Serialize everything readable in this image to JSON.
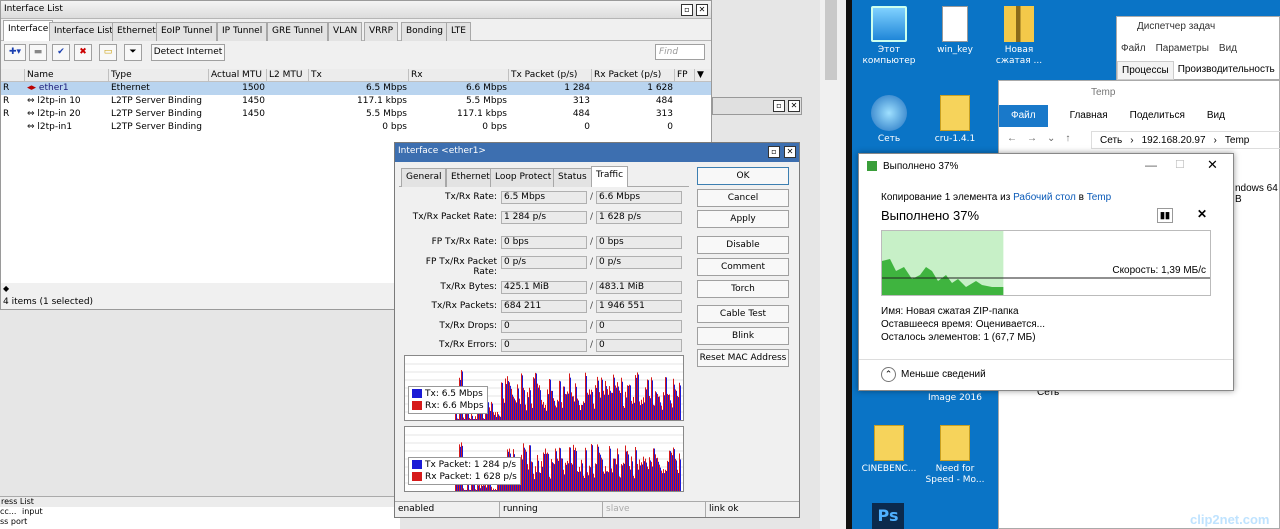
{
  "interface_list": {
    "title": "Interface List",
    "tabs": [
      "Interface",
      "Interface List",
      "Ethernet",
      "EoIP Tunnel",
      "IP Tunnel",
      "GRE Tunnel",
      "VLAN",
      "VRRP",
      "Bonding",
      "LTE"
    ],
    "detect_label": "Detect Internet",
    "find_placeholder": "Find",
    "columns": [
      "Name",
      "Type",
      "Actual MTU",
      "L2 MTU",
      "Tx",
      "Rx",
      "Tx Packet (p/s)",
      "Rx Packet (p/s)",
      "FP"
    ],
    "rows": [
      {
        "flag": "R",
        "name": "ether1",
        "type": "Ethernet",
        "mtu": "1500",
        "l2mtu": "",
        "tx": "6.5 Mbps",
        "rx": "6.6 Mbps",
        "txp": "1 284",
        "rxp": "1 628"
      },
      {
        "flag": "R",
        "name": "l2tp-in 10",
        "type": "L2TP Server Binding",
        "mtu": "1450",
        "l2mtu": "",
        "tx": "117.1 kbps",
        "rx": "5.5 Mbps",
        "txp": "313",
        "rxp": "484"
      },
      {
        "flag": "R",
        "name": "l2tp-in 20",
        "type": "L2TP Server Binding",
        "mtu": "1450",
        "l2mtu": "",
        "tx": "5.5 Mbps",
        "rx": "117.1 kbps",
        "txp": "484",
        "rxp": "313"
      },
      {
        "flag": "",
        "name": "l2tp-in1",
        "type": "L2TP Server Binding",
        "mtu": "",
        "l2mtu": "",
        "tx": "0 bps",
        "rx": "0 bps",
        "txp": "0",
        "rxp": "0"
      }
    ],
    "status": "4 items (1 selected)"
  },
  "bottom_strip": {
    "title": "ress List",
    "r1a": "cc...",
    "r1b": "input",
    "r2": "ss port"
  },
  "dialog": {
    "title": "Interface <ether1>",
    "tabs": [
      "General",
      "Ethernet",
      "Loop Protect",
      "Status",
      "Traffic"
    ],
    "fields": [
      {
        "label": "Tx/Rx Rate:",
        "a": "6.5 Mbps",
        "b": "6.6 Mbps"
      },
      {
        "label": "Tx/Rx Packet Rate:",
        "a": "1 284 p/s",
        "b": "1 628 p/s"
      },
      {
        "label": "FP Tx/Rx Rate:",
        "a": "0 bps",
        "b": "0 bps"
      },
      {
        "label": "FP Tx/Rx Packet Rate:",
        "a": "0 p/s",
        "b": "0 p/s"
      },
      {
        "label": "Tx/Rx Bytes:",
        "a": "425.1 MiB",
        "b": "483.1 MiB"
      },
      {
        "label": "Tx/Rx Packets:",
        "a": "684 211",
        "b": "1 946 551"
      },
      {
        "label": "Tx/Rx Drops:",
        "a": "0",
        "b": "0"
      },
      {
        "label": "Tx/Rx Errors:",
        "a": "0",
        "b": "0"
      }
    ],
    "buttons": [
      "OK",
      "Cancel",
      "Apply",
      "Disable",
      "Comment",
      "Torch",
      "Cable Test",
      "Blink",
      "Reset MAC Address"
    ],
    "legend1": {
      "tx": "Tx:  6.5 Mbps",
      "rx": "Rx:  6.6 Mbps"
    },
    "legend2": {
      "tx": "Tx Packet:  1 284 p/s",
      "rx": "Rx Packet:  1 628 p/s"
    },
    "status": [
      "enabled",
      "running",
      "slave",
      "link ok"
    ],
    "colors": {
      "tx": "#1a1ad6",
      "rx": "#d61a1a"
    }
  },
  "desktop": {
    "icons": [
      {
        "label": "Этот компьютер",
        "icon": "computer-icon"
      },
      {
        "label": "win_key",
        "icon": "document-icon"
      },
      {
        "label": "Новая сжатая ...",
        "icon": "zip-folder-icon"
      },
      {
        "label": "Сеть",
        "icon": "network-icon"
      },
      {
        "label": "cru-1.4.1",
        "icon": "folder-icon"
      },
      {
        "label": "Image 2016",
        "icon": "folder-icon"
      },
      {
        "label": "CINEBENC...",
        "icon": "folder-icon"
      },
      {
        "label": "Need for Speed - Mo...",
        "icon": "folder-icon"
      }
    ],
    "taskmgr": {
      "title": "Диспетчер задач",
      "menu": [
        "Файл",
        "Параметры",
        "Вид"
      ],
      "tabs": [
        "Процессы",
        "Производительность"
      ]
    },
    "explorer": {
      "title": "Temp",
      "ribbon": [
        "Файл",
        "Главная",
        "Поделиться",
        "Вид"
      ],
      "path": [
        "Сеть",
        "192.168.20.97",
        "Temp"
      ],
      "side_text": "ndows 64 B",
      "item": "Сеть"
    },
    "copy": {
      "title": "Выполнено 37%",
      "line1_pre": "Копирование 1 элемента из ",
      "line1_src": "Рабочий стол",
      "line1_mid": " в ",
      "line1_dst": "Temp",
      "big": "Выполнено 37%",
      "speed": "Скорость: 1,39 МБ/с",
      "progress": 37,
      "name": "Имя:  Новая сжатая ZIP-папка",
      "time": "Оставшееся время:  Оценивается...",
      "items": "Осталось элементов:  1 (67,7 МБ)",
      "less": "Меньше сведений"
    },
    "watermark": "clip2net.com"
  }
}
